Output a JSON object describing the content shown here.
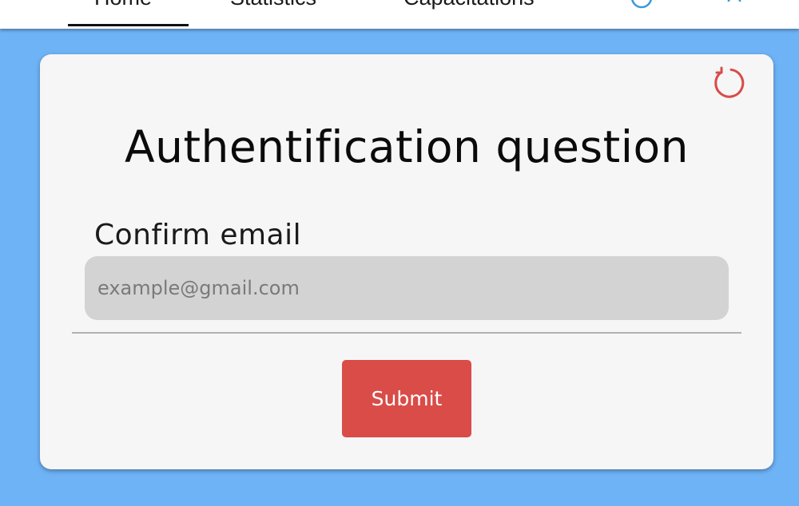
{
  "nav": {
    "tabs": [
      {
        "label": "Home",
        "active": true
      },
      {
        "label": "Statistics",
        "active": false
      },
      {
        "label": "Capacitations",
        "active": false
      }
    ],
    "icons": [
      "help-circle-icon",
      "translate-icon"
    ],
    "icon_color": "#3a9ad9"
  },
  "card": {
    "refresh_icon": "refresh-icon",
    "refresh_color": "#d94c48",
    "title": "Authentification question",
    "field_label": "Confirm email",
    "email_placeholder": "example@gmail.com",
    "email_value": "",
    "submit_label": "Submit"
  },
  "colors": {
    "background": "#6fb3f7",
    "card": "#f6f6f6",
    "input": "#d3d3d3",
    "accent": "#d94c48"
  }
}
